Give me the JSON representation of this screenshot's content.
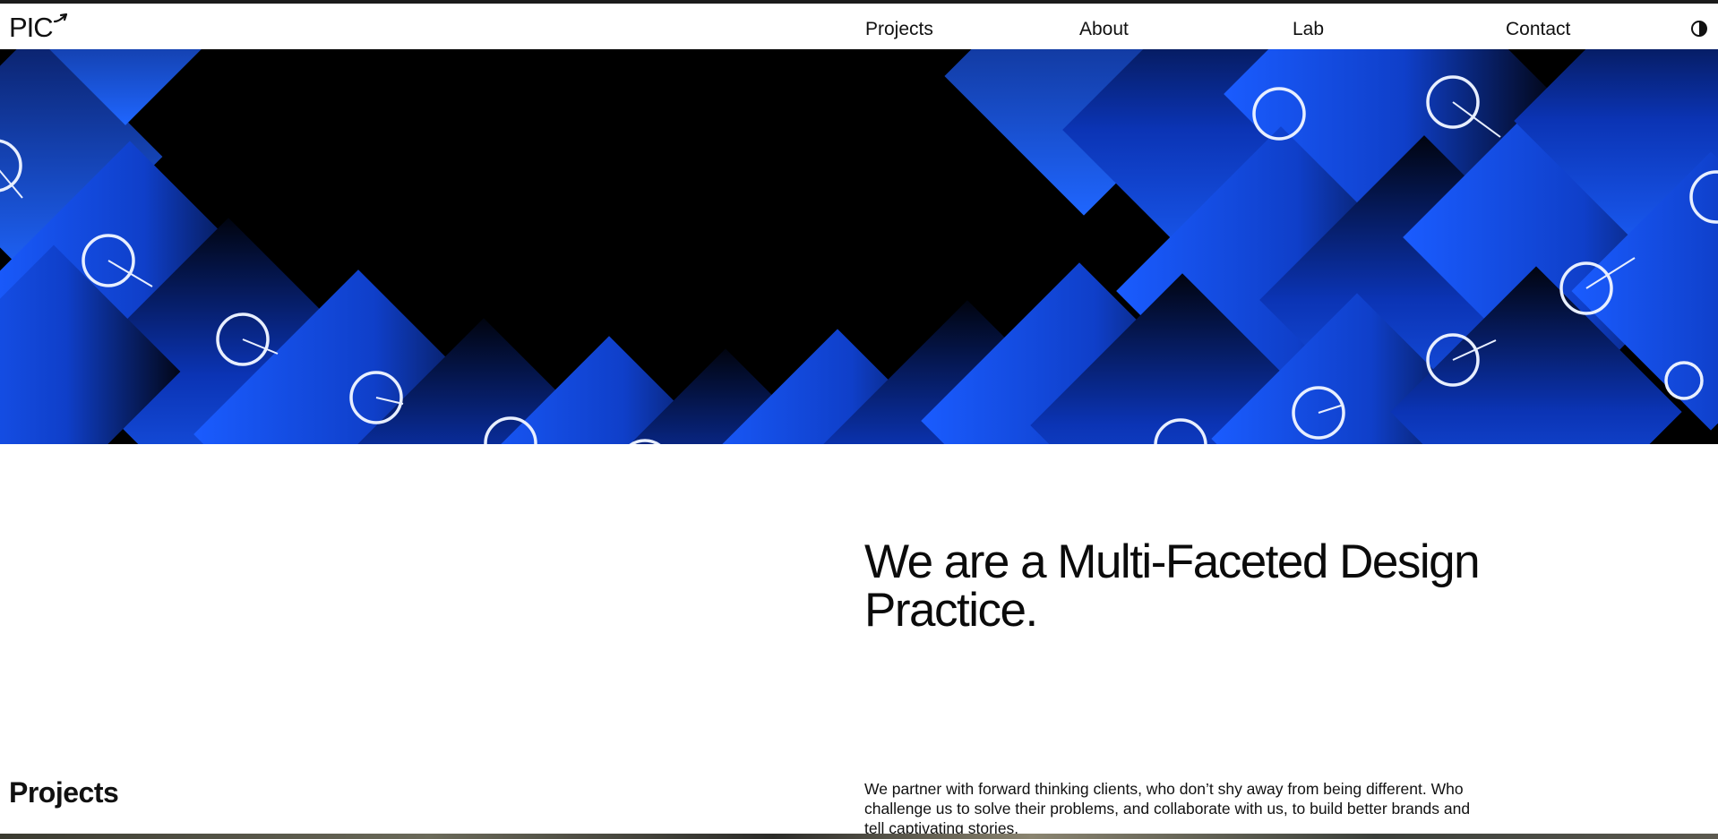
{
  "header": {
    "logo_text": "PIC",
    "nav": {
      "projects": "Projects",
      "about": "About",
      "lab": "Lab",
      "contact": "Contact"
    },
    "theme_toggle_icon": "contrast-icon"
  },
  "hero": {
    "image": "abstract-blue-squares-with-circles",
    "accent_color": "#1a5cff"
  },
  "main": {
    "headline": "We are a Multi-Faceted Design Practice.",
    "section_title": "Projects",
    "intro": "We partner with forward thinking clients, who don’t shy away from being different. Who challenge us to solve their problems, and collaborate with us, to build better brands and tell captivating stories."
  }
}
